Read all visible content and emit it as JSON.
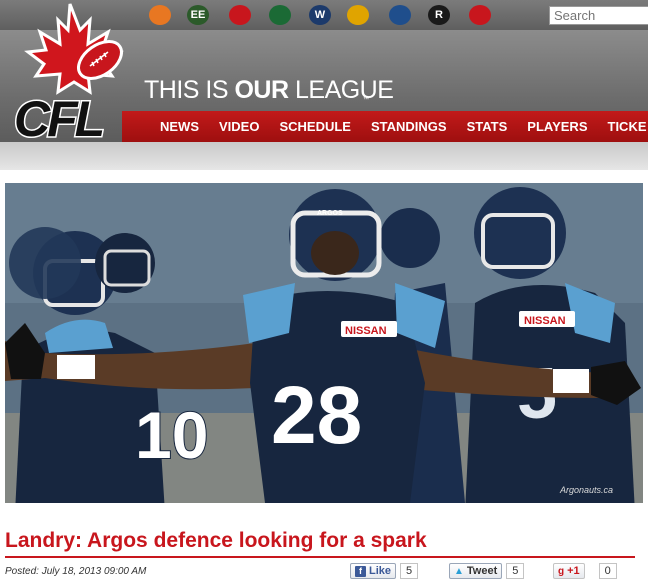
{
  "team_strip": {
    "teams": [
      {
        "name": "bc-lions-logo",
        "glyph": "",
        "color": "#e87722"
      },
      {
        "name": "edmonton-eskimos-logo",
        "glyph": "EE",
        "color": "#2b5a2a"
      },
      {
        "name": "calgary-stampeders-logo",
        "glyph": "",
        "color": "#c8161d"
      },
      {
        "name": "saskatchewan-roughriders-logo",
        "glyph": "",
        "color": "#1b6a35"
      },
      {
        "name": "winnipeg-blue-bombers-logo",
        "glyph": "W",
        "color": "#1c3a6b"
      },
      {
        "name": "hamilton-tiger-cats-logo",
        "glyph": "",
        "color": "#e0a400"
      },
      {
        "name": "toronto-argonauts-logo",
        "glyph": "",
        "color": "#1f4e8c"
      },
      {
        "name": "ottawa-redblacks-logo",
        "glyph": "R",
        "color": "#1a1a1a"
      },
      {
        "name": "montreal-alouettes-logo",
        "glyph": "",
        "color": "#c8161d"
      }
    ],
    "search_placeholder": "Search"
  },
  "header": {
    "logo_text": "CFL",
    "tagline_pre": "THIS IS",
    "tagline_bold": "OUR",
    "tagline_post": "LEAGUE",
    "trademark": "™",
    "nav": [
      "NEWS",
      "VIDEO",
      "SCHEDULE",
      "STANDINGS",
      "STATS",
      "PLAYERS",
      "TICKE"
    ]
  },
  "hero": {
    "photo_credit": "Argonauts.ca",
    "jersey_number_center": "28",
    "jersey_number_left": "10",
    "jersey_sponsor": "NISSAN",
    "helmet_text": "ARGOS"
  },
  "article": {
    "headline": "Landry: Argos defence looking for a spark",
    "posted": "Posted: July 18, 2013 09:00 AM",
    "share": {
      "like_label": "Like",
      "like_count": "5",
      "tweet_label": "Tweet",
      "tweet_count": "5",
      "plusone_label": "+1",
      "plusone_count": "0"
    }
  },
  "colors": {
    "brand_red": "#c8161d",
    "header_gray": "#6c6c6c",
    "jersey_navy": "#17263f",
    "jersey_light_blue": "#5aa0d0"
  }
}
